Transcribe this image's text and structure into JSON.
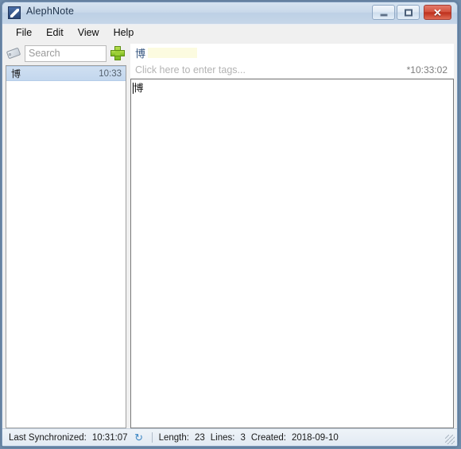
{
  "window": {
    "title": "AlephNote",
    "app_icon": "alephnote-logo-icon",
    "controls": {
      "minimize": "minimize-button",
      "maximize": "maximize-button",
      "close_label": "✕"
    }
  },
  "menubar": {
    "items": [
      {
        "label": "File"
      },
      {
        "label": "Edit"
      },
      {
        "label": "View"
      },
      {
        "label": "Help"
      }
    ]
  },
  "sidebar": {
    "tag_icon": "tag-icon",
    "search": {
      "value": "",
      "placeholder": "Search"
    },
    "add_button_label": "+",
    "notes": [
      {
        "title": "博",
        "time": "10:33",
        "selected": true
      }
    ]
  },
  "note": {
    "title_glyph": "博",
    "tags_placeholder": "Click here to enter tags...",
    "timestamp": "*10:33:02",
    "body": "博"
  },
  "statusbar": {
    "sync_label": "Last Synchronized:",
    "sync_time": "10:31:07",
    "sync_icon": "↻",
    "length_label": "Length:",
    "length_value": "23",
    "lines_label": "Lines:",
    "lines_value": "3",
    "created_label": "Created:",
    "created_value": "2018-09-10"
  },
  "colors": {
    "accent_blue": "#3e87c4",
    "selection_blue": "#c9dbef",
    "add_green": "#8fc926",
    "close_red": "#c63a23",
    "title_bar": "#c9d9ea"
  }
}
